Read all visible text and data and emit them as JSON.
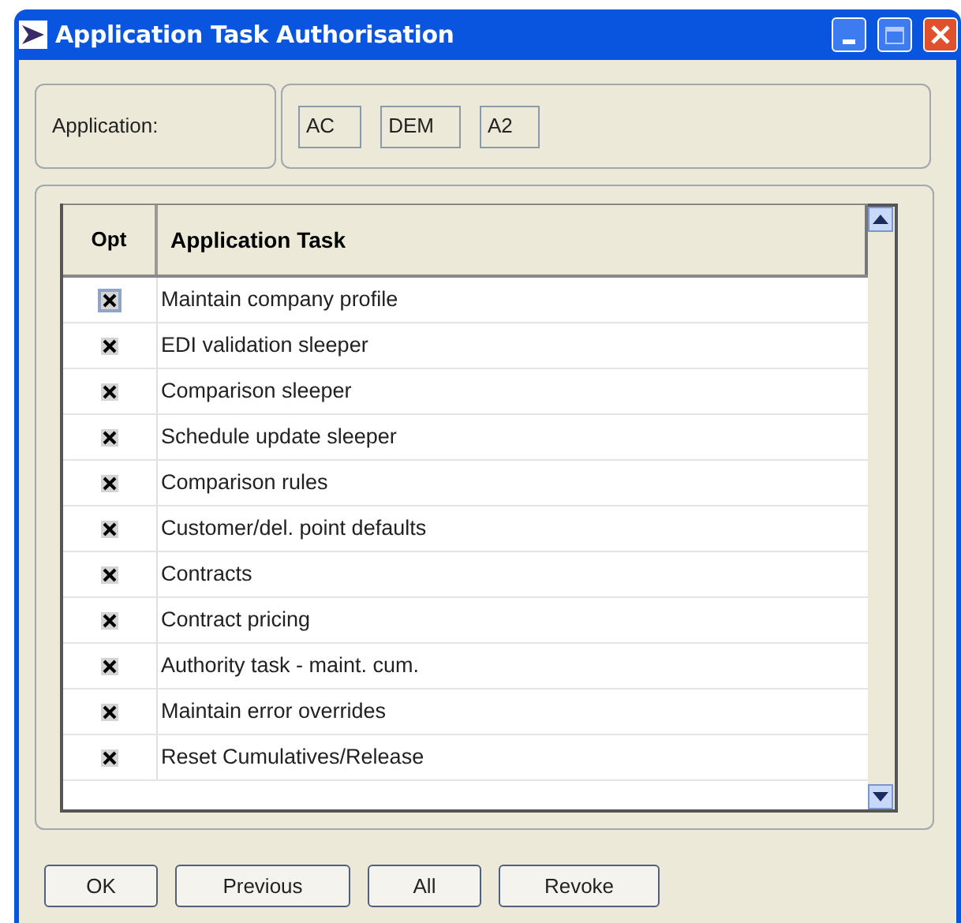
{
  "window": {
    "title": "Application Task Authorisation"
  },
  "application": {
    "label": "Application:",
    "codes": [
      "AC",
      "DEM",
      "A2"
    ]
  },
  "table": {
    "columns": [
      "Opt",
      "Application Task"
    ],
    "rows": [
      {
        "task": "Maintain company profile",
        "checked": true,
        "selected": true
      },
      {
        "task": "EDI validation sleeper",
        "checked": true,
        "selected": false
      },
      {
        "task": "Comparison sleeper",
        "checked": true,
        "selected": false
      },
      {
        "task": "Schedule update sleeper",
        "checked": true,
        "selected": false
      },
      {
        "task": "Comparison rules",
        "checked": true,
        "selected": false
      },
      {
        "task": "Customer/del. point defaults",
        "checked": true,
        "selected": false
      },
      {
        "task": "Contracts",
        "checked": true,
        "selected": false
      },
      {
        "task": "Contract pricing",
        "checked": true,
        "selected": false
      },
      {
        "task": "Authority task - maint. cum.",
        "checked": true,
        "selected": false
      },
      {
        "task": "Maintain error overrides",
        "checked": true,
        "selected": false
      },
      {
        "task": "Reset Cumulatives/Release",
        "checked": true,
        "selected": false
      }
    ]
  },
  "buttons": [
    "OK",
    "Previous",
    "All",
    "Revoke"
  ]
}
